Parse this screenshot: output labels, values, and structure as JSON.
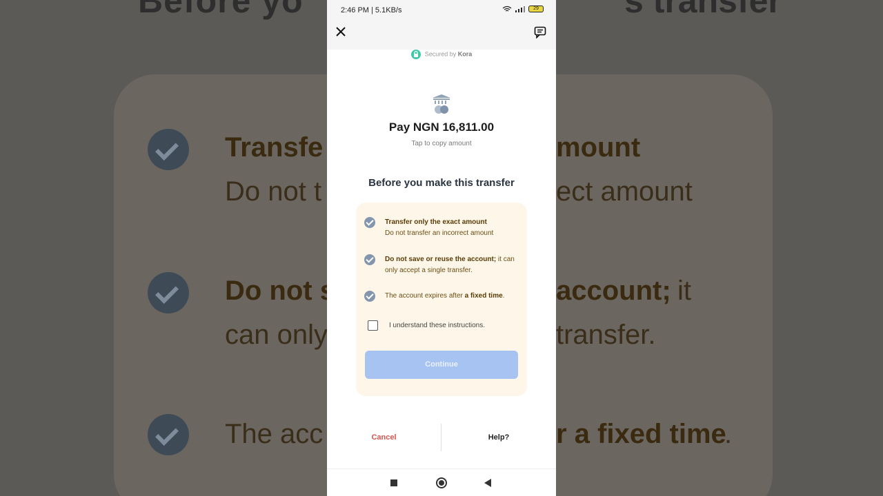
{
  "background": {
    "title_left": "Before yo",
    "title_right": "s transfer",
    "lines": [
      {
        "bold": "Transfe",
        "tail": "mount"
      },
      {
        "normal": "Do not t",
        "tail": "ect amount"
      },
      {
        "bold": "Do not s",
        "tail_bold": "account;",
        "tail": " it"
      },
      {
        "normal": "can only",
        "tail": "transfer."
      },
      {
        "normal": "The acc",
        "tail_bold": "r a fixed time",
        "tail": "."
      }
    ]
  },
  "status_bar": {
    "time": "2:46 PM | 5.1KB/s",
    "battery": "29"
  },
  "secured": {
    "prefix": "Secured by",
    "brand": "Kora"
  },
  "payment": {
    "amount": "Pay NGN 16,811.00",
    "copy_hint": "Tap to copy amount"
  },
  "heading": "Before you make this transfer",
  "instructions": [
    {
      "bold": "Transfer only the exact amount",
      "text": "Do not transfer an incorrect amount"
    },
    {
      "bold": "Do not save or reuse the account;",
      "text": " it can only accept a single transfer."
    },
    {
      "text_pre": "The account expires after ",
      "bold": "a fixed time",
      "text": "."
    }
  ],
  "checkbox_label": "I understand these instructions.",
  "continue_label": "Continue",
  "footer": {
    "cancel": "Cancel",
    "help": "Help?"
  },
  "colors": {
    "accent": "#a7c3f1",
    "cancel": "#d9534f",
    "card_bg": "#fdf6e9",
    "lock": "#3fc9a8"
  }
}
